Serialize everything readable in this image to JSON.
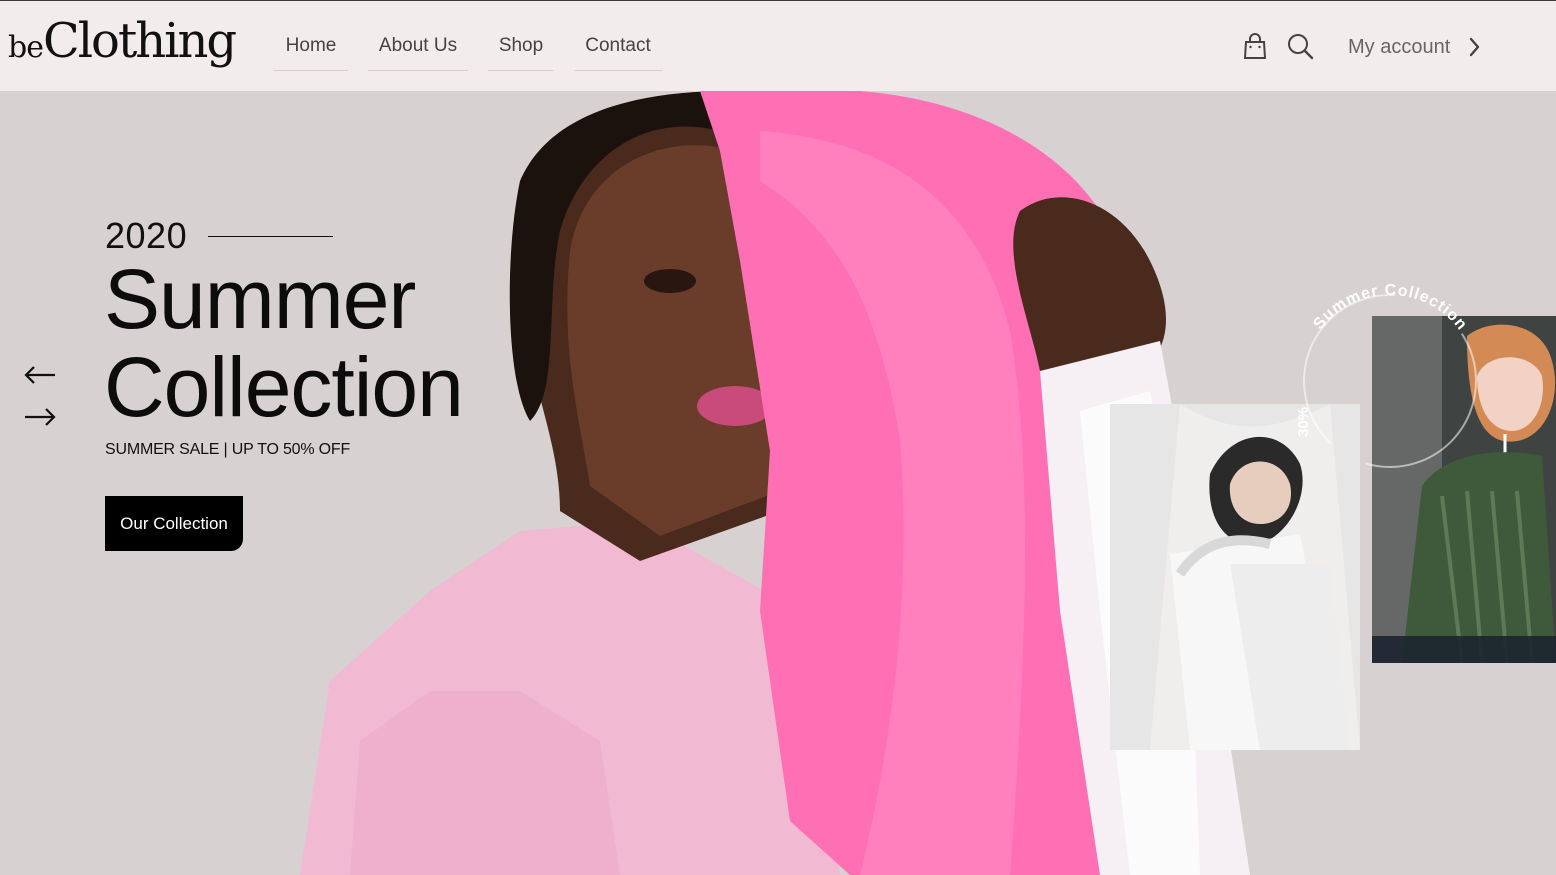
{
  "header": {
    "logo_prefix": "be",
    "logo_main": "Clothing",
    "nav": [
      "Home",
      "About Us",
      "Shop",
      "Contact"
    ],
    "account_label": "My account",
    "icons": [
      "bag-icon",
      "search-icon",
      "chevron-right-icon"
    ]
  },
  "hero": {
    "year": "2020",
    "headline_line1": "Summer",
    "headline_line2": "Collection",
    "sale_text": "SUMMER SALE | UP TO 50% OFF",
    "cta_label": "Our Collection",
    "badge_text": "Summer Collection",
    "badge_percent": "30%",
    "icons": [
      "arrow-left-icon",
      "arrow-right-icon"
    ]
  },
  "colors": {
    "header_bg": "#f3eced",
    "hero_bg": "#d7d1d1",
    "accent_pink": "#ff7fb6",
    "cta_bg": "#000000"
  }
}
